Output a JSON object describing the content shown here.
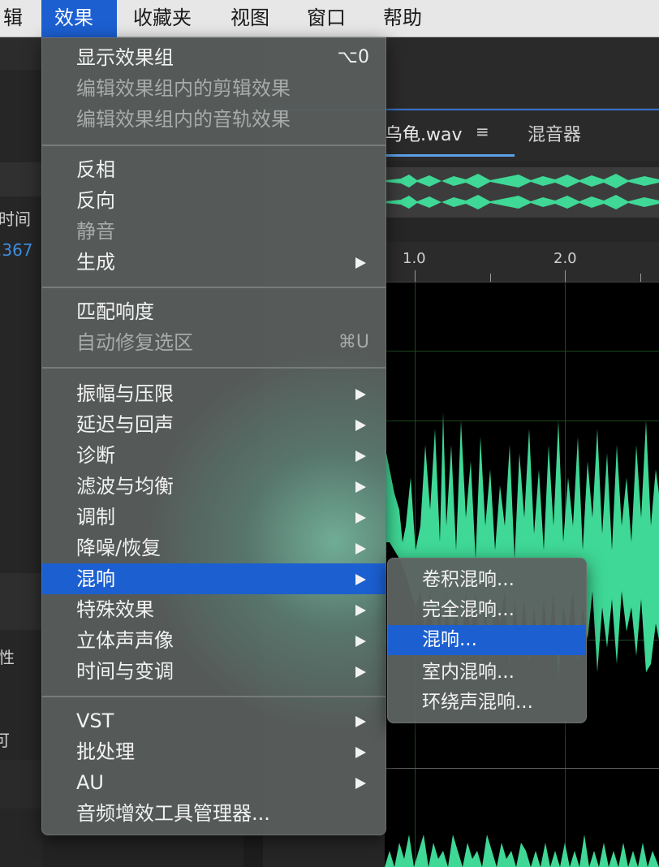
{
  "menubar": {
    "items": [
      {
        "label": "辑",
        "active": false
      },
      {
        "label": "效果",
        "active": true
      },
      {
        "label": "收藏夹",
        "active": false
      },
      {
        "label": "视图",
        "active": false
      },
      {
        "label": "窗口",
        "active": false
      },
      {
        "label": "帮助",
        "active": false
      }
    ]
  },
  "left_panel": {
    "time_header": "时间",
    "time_value": ".367",
    "prop_label": "性",
    "misc_glyph": "可"
  },
  "editor": {
    "file_tab": "乌龟.wav",
    "tab_menu_icon": "≡",
    "mixer_tab": "混音器",
    "ruler": [
      "1.0",
      "2.0"
    ]
  },
  "effects_menu": {
    "show_effects_rack": "显示效果组",
    "show_effects_rack_shortcut": "⌥0",
    "edit_clip_effects": "编辑效果组内的剪辑效果",
    "edit_track_effects": "编辑效果组内的音轨效果",
    "invert": "反相",
    "reverse": "反向",
    "silence": "静音",
    "generate": "生成",
    "match_loudness": "匹配响度",
    "auto_heal": "自动修复选区",
    "auto_heal_shortcut": "⌘U",
    "amplitude": "振幅与压限",
    "delay_echo": "延迟与回声",
    "diagnostics": "诊断",
    "filter_eq": "滤波与均衡",
    "modulation": "调制",
    "noise_reduction": "降噪/恢复",
    "reverb": "混响",
    "special": "特殊效果",
    "stereo_imagery": "立体声声像",
    "time_pitch": "时间与变调",
    "vst": "VST",
    "batch": "批处理",
    "au": "AU",
    "plugin_manager": "音频增效工具管理器..."
  },
  "reverb_submenu": {
    "convolution": "卷积混响...",
    "full": "完全混响...",
    "reverb": "混响...",
    "studio": "室内混响...",
    "surround": "环绕声混响..."
  },
  "colors": {
    "menu_highlight": "#1c5fd1",
    "waveform": "#3fd896",
    "time_blue": "#3d8fe0"
  }
}
